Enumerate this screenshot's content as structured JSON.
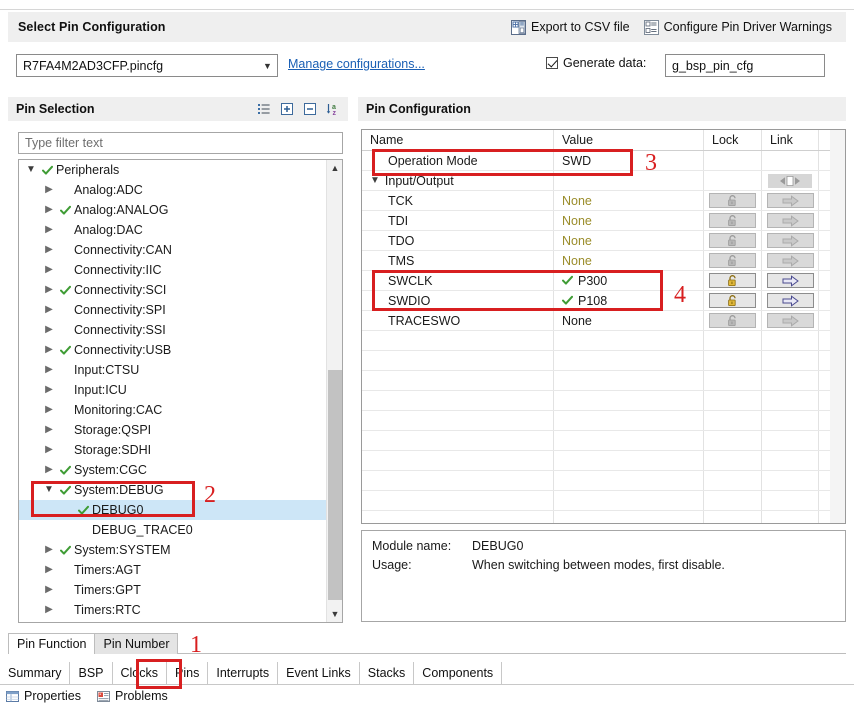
{
  "header": {
    "title": "Select Pin Configuration",
    "actions": [
      {
        "label": "Export to CSV file",
        "icon": "export-csv-icon"
      },
      {
        "label": "Configure Pin Driver Warnings",
        "icon": "pin-driver-warnings-icon"
      }
    ]
  },
  "config_row": {
    "combo_value": "R7FA4M2AD3CFP.pincfg",
    "manage_link": "Manage configurations...",
    "generate_checkbox_label": "Generate data:",
    "generate_checked": true,
    "generate_value": "g_bsp_pin_cfg"
  },
  "pin_selection": {
    "title": "Pin Selection",
    "toolbar_icons": [
      "list-view-icon",
      "expand-all-icon",
      "collapse-all-icon",
      "sort-alphabetical-icon"
    ],
    "filter_placeholder": "Type filter text",
    "tree": [
      {
        "label": "Peripherals",
        "depth": 0,
        "twisty": "open",
        "check": true,
        "selected": false
      },
      {
        "label": "Analog:ADC",
        "depth": 1,
        "twisty": "closed",
        "check": false,
        "selected": false
      },
      {
        "label": "Analog:ANALOG",
        "depth": 1,
        "twisty": "closed",
        "check": true,
        "selected": false
      },
      {
        "label": "Analog:DAC",
        "depth": 1,
        "twisty": "closed",
        "check": false,
        "selected": false
      },
      {
        "label": "Connectivity:CAN",
        "depth": 1,
        "twisty": "closed",
        "check": false,
        "selected": false
      },
      {
        "label": "Connectivity:IIC",
        "depth": 1,
        "twisty": "closed",
        "check": false,
        "selected": false
      },
      {
        "label": "Connectivity:SCI",
        "depth": 1,
        "twisty": "closed",
        "check": true,
        "selected": false
      },
      {
        "label": "Connectivity:SPI",
        "depth": 1,
        "twisty": "closed",
        "check": false,
        "selected": false
      },
      {
        "label": "Connectivity:SSI",
        "depth": 1,
        "twisty": "closed",
        "check": false,
        "selected": false
      },
      {
        "label": "Connectivity:USB",
        "depth": 1,
        "twisty": "closed",
        "check": true,
        "selected": false
      },
      {
        "label": "Input:CTSU",
        "depth": 1,
        "twisty": "closed",
        "check": false,
        "selected": false
      },
      {
        "label": "Input:ICU",
        "depth": 1,
        "twisty": "closed",
        "check": false,
        "selected": false
      },
      {
        "label": "Monitoring:CAC",
        "depth": 1,
        "twisty": "closed",
        "check": false,
        "selected": false
      },
      {
        "label": "Storage:QSPI",
        "depth": 1,
        "twisty": "closed",
        "check": false,
        "selected": false
      },
      {
        "label": "Storage:SDHI",
        "depth": 1,
        "twisty": "closed",
        "check": false,
        "selected": false
      },
      {
        "label": "System:CGC",
        "depth": 1,
        "twisty": "closed",
        "check": true,
        "selected": false
      },
      {
        "label": "System:DEBUG",
        "depth": 1,
        "twisty": "open",
        "check": true,
        "selected": false
      },
      {
        "label": "DEBUG0",
        "depth": 2,
        "twisty": "none",
        "check": true,
        "selected": true
      },
      {
        "label": "DEBUG_TRACE0",
        "depth": 2,
        "twisty": "none",
        "check": false,
        "selected": false
      },
      {
        "label": "System:SYSTEM",
        "depth": 1,
        "twisty": "closed",
        "check": true,
        "selected": false
      },
      {
        "label": "Timers:AGT",
        "depth": 1,
        "twisty": "closed",
        "check": false,
        "selected": false
      },
      {
        "label": "Timers:GPT",
        "depth": 1,
        "twisty": "closed",
        "check": false,
        "selected": false
      },
      {
        "label": "Timers:RTC",
        "depth": 1,
        "twisty": "closed",
        "check": false,
        "selected": false
      }
    ]
  },
  "pin_configuration": {
    "title": "Pin Configuration",
    "columns": [
      "Name",
      "Value",
      "Lock",
      "Link"
    ],
    "rows": [
      {
        "name": "Operation Mode",
        "value": "SWD",
        "indent": 1,
        "value_state": "plain",
        "lock": "none",
        "link": "none",
        "group": false
      },
      {
        "name": "Input/Output",
        "value": "",
        "indent": 0,
        "value_state": "plain",
        "lock": "none",
        "link": "group",
        "group": true
      },
      {
        "name": "TCK",
        "value": "None",
        "indent": 1,
        "value_state": "none",
        "lock": "disabled",
        "link": "disabled",
        "group": false
      },
      {
        "name": "TDI",
        "value": "None",
        "indent": 1,
        "value_state": "none",
        "lock": "disabled",
        "link": "disabled",
        "group": false
      },
      {
        "name": "TDO",
        "value": "None",
        "indent": 1,
        "value_state": "none",
        "lock": "disabled",
        "link": "disabled",
        "group": false
      },
      {
        "name": "TMS",
        "value": "None",
        "indent": 1,
        "value_state": "none",
        "lock": "disabled",
        "link": "disabled",
        "group": false
      },
      {
        "name": "SWCLK",
        "value": "P300",
        "indent": 1,
        "value_state": "ok",
        "lock": "enabled",
        "link": "enabled",
        "group": false
      },
      {
        "name": "SWDIO",
        "value": "P108",
        "indent": 1,
        "value_state": "ok",
        "lock": "enabled",
        "link": "enabled",
        "group": false
      },
      {
        "name": "TRACESWO",
        "value": "None",
        "indent": 1,
        "value_state": "plain",
        "lock": "disabled",
        "link": "disabled",
        "group": false
      }
    ],
    "empty_row_count": 10
  },
  "info": {
    "module_name_label": "Module name:",
    "module_name_value": "DEBUG0",
    "usage_label": "Usage:",
    "usage_value": "When switching between modes, first disable."
  },
  "sub_tabs": [
    {
      "label": "Pin Function",
      "active": true
    },
    {
      "label": "Pin Number",
      "active": false
    }
  ],
  "bottom_tabs": [
    {
      "label": "Summary",
      "active": false
    },
    {
      "label": "BSP",
      "active": false
    },
    {
      "label": "Clocks",
      "active": false
    },
    {
      "label": "Pins",
      "active": true
    },
    {
      "label": "Interrupts",
      "active": false
    },
    {
      "label": "Event Links",
      "active": false
    },
    {
      "label": "Stacks",
      "active": false
    },
    {
      "label": "Components",
      "active": false
    }
  ],
  "view_bar": [
    {
      "label": "Properties",
      "icon": "properties-icon"
    },
    {
      "label": "Problems",
      "icon": "problems-icon"
    }
  ],
  "annotations": [
    {
      "number": "1",
      "target": "pins-bottom-tab"
    },
    {
      "number": "2",
      "target": "system-debug-tree-node"
    },
    {
      "number": "3",
      "target": "operation-mode-row"
    },
    {
      "number": "4",
      "target": "swclk-swdio-rows"
    }
  ],
  "colors": {
    "annotation_red": "#d81f20",
    "selection_blue": "#cde6f7",
    "link_blue": "#1a5fb4",
    "value_none_olive": "#9a8c2a",
    "check_green": "#3f9c35",
    "lock_gold": "#e0b83a"
  }
}
